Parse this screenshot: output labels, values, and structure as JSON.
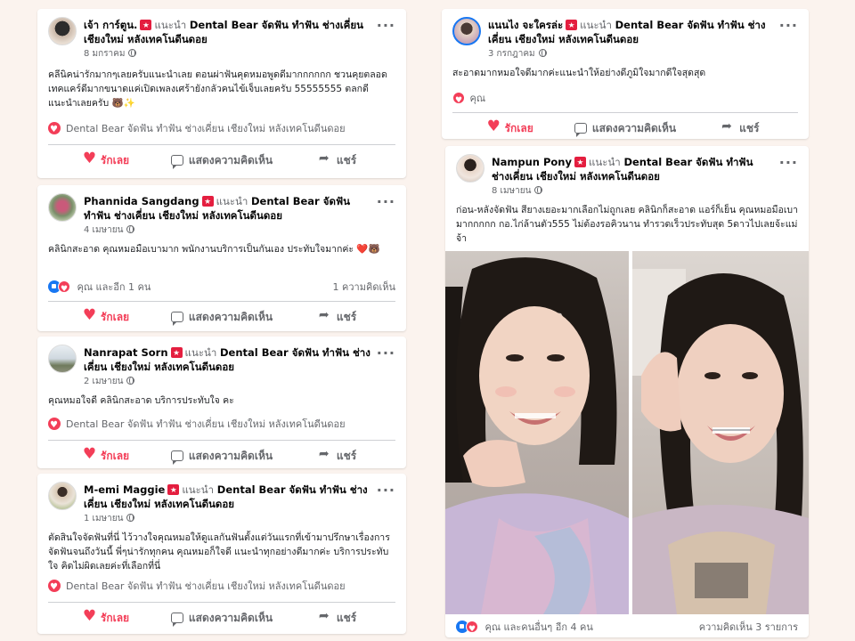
{
  "colors": {
    "background": "#fbf3ee",
    "love": "#f33e58",
    "like": "#1877f2",
    "muted": "#65676b"
  },
  "actions": {
    "love": "รักเลย",
    "comment": "แสดงความคิดเห็น",
    "share": "แชร์"
  },
  "rec_word": "แนะนำ",
  "page_name": "Dental Bear จัดฟัน ทำฟัน ช่างเคี่ยน เชียงใหม่ หลังเทคโนดีนดอย",
  "posts": [
    {
      "author": "เจ้า การ์ตูน.",
      "date": "8 มกราคม",
      "text": "คลีนิคน่ารักมากๆเลยครับแนะนำเลย ตอนผ่าฟันคุดหมอพูดดีมากกกกกก ชวนคุยตลอด เทคแคร์ดีมากขนาดแค่เปิดเพลงเศร้ายังกลัวคนไข้เจ็บเลยครับ 55555555 ตลกดี แนะนำเลยครับ 🐻✨",
      "rec_line": "Dental Bear จัดฟัน ทำฟัน ช่างเคี่ยน เชียงใหม่ หลังเทคโนดีนดอย"
    },
    {
      "author": "Phannida Sangdang",
      "date": "4 เมษายน",
      "text": "คลินิกสะอาด คุณหมอมือเบามาก พนักงานบริการเป็นกันเอง ประทับใจมากค่ะ ❤️🐻",
      "stats_left": "คุณ และอีก 1 คน",
      "stats_right": "1 ความคิดเห็น"
    },
    {
      "author": "Nanrapat Sorn",
      "date": "2 เมษายน",
      "text": "คุณหมอใจดี คลินิกสะอาด บริการประทับใจ คะ",
      "rec_line": "Dental Bear จัดฟัน ทำฟัน ช่างเคี่ยน เชียงใหม่ หลังเทคโนดีนดอย"
    },
    {
      "author": "M-emi Maggie",
      "date": "1 เมษายน",
      "text": "ตัดสินใจจัดฟันที่นี่ ไว้วางใจคุณหมอให้ดูแลกันฟันตั้งแต่วันแรกที่เข้ามาปรึกษาเรื่องการจัดฟันจนถึงวันนี้ พี่ๆน่ารักทุกคน คุณหมอก็ใจดี แนะนำทุกอย่างดีมากค่ะ บริการประทับใจ คิดไม่ผิดเลยค่ะที่เลือกที่นี่",
      "rec_line": "Dental Bear จัดฟัน ทำฟัน ช่างเคี่ยน เชียงใหม่ หลังเทคโนดีนดอย"
    },
    {
      "author": "แนนไง จะใครล่ะ",
      "date": "3 กรกฎาคม",
      "text": "สะอาดมากหมอใจดีมากค่ะแนะนำให้อย่างดีภูมิใจมากดีใจสุดสุด",
      "stats_left": "คุณ"
    },
    {
      "author": "Nampun Pony",
      "date": "8 เมษายน",
      "text": "ก่อน-หลังจัดฟัน สียางเยอะมากเลือกไม่ถูกเลย คลินิกก็สะอาด แอร์ก็เย็น คุณหมอมือเบามากกกกก กอ.ไก่ล้านตัว555 ไม่ต้องรอคิวนาน ทำรวดเร็วประทับสุด 5ดาวไปเลยจ้ะแม่จ้า",
      "stats_left": "คุณ และคนอื่นๆ อีก 4 คน",
      "stats_right": "ความคิดเห็น 3 รายการ"
    }
  ]
}
